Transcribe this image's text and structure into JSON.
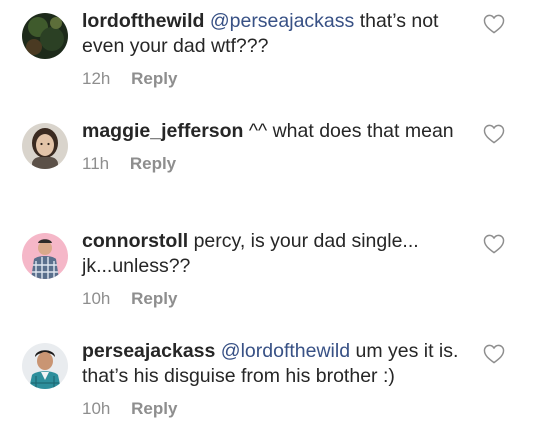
{
  "comments": [
    {
      "username": "lordofthewild",
      "mention": "@perseajackass",
      "text": " that’s not even your dad wtf???",
      "time": "12h",
      "reply_label": "Reply",
      "avatar": "avatar-dark-green",
      "like_icon": "heart-outline-icon"
    },
    {
      "username": "maggie_jefferson",
      "mention": "",
      "text": " ^^ what does that mean",
      "time": "11h",
      "reply_label": "Reply",
      "avatar": "avatar-woman-portrait",
      "like_icon": "heart-outline-icon"
    },
    {
      "username": "connorstoll",
      "mention": "",
      "text": " percy, is your dad single... jk...unless??",
      "time": "10h",
      "reply_label": "Reply",
      "avatar": "avatar-pink-plaid",
      "like_icon": "heart-outline-icon"
    },
    {
      "username": "perseajackass",
      "mention": "@lordofthewild",
      "text": " um yes it is. that’s his disguise from his brother :)",
      "time": "10h",
      "reply_label": "Reply",
      "avatar": "avatar-man-teal",
      "like_icon": "heart-outline-icon"
    }
  ],
  "colors": {
    "text": "#262626",
    "meta": "#8e8e8e",
    "mention": "#385185",
    "heart_stroke": "#8e8e8e"
  }
}
